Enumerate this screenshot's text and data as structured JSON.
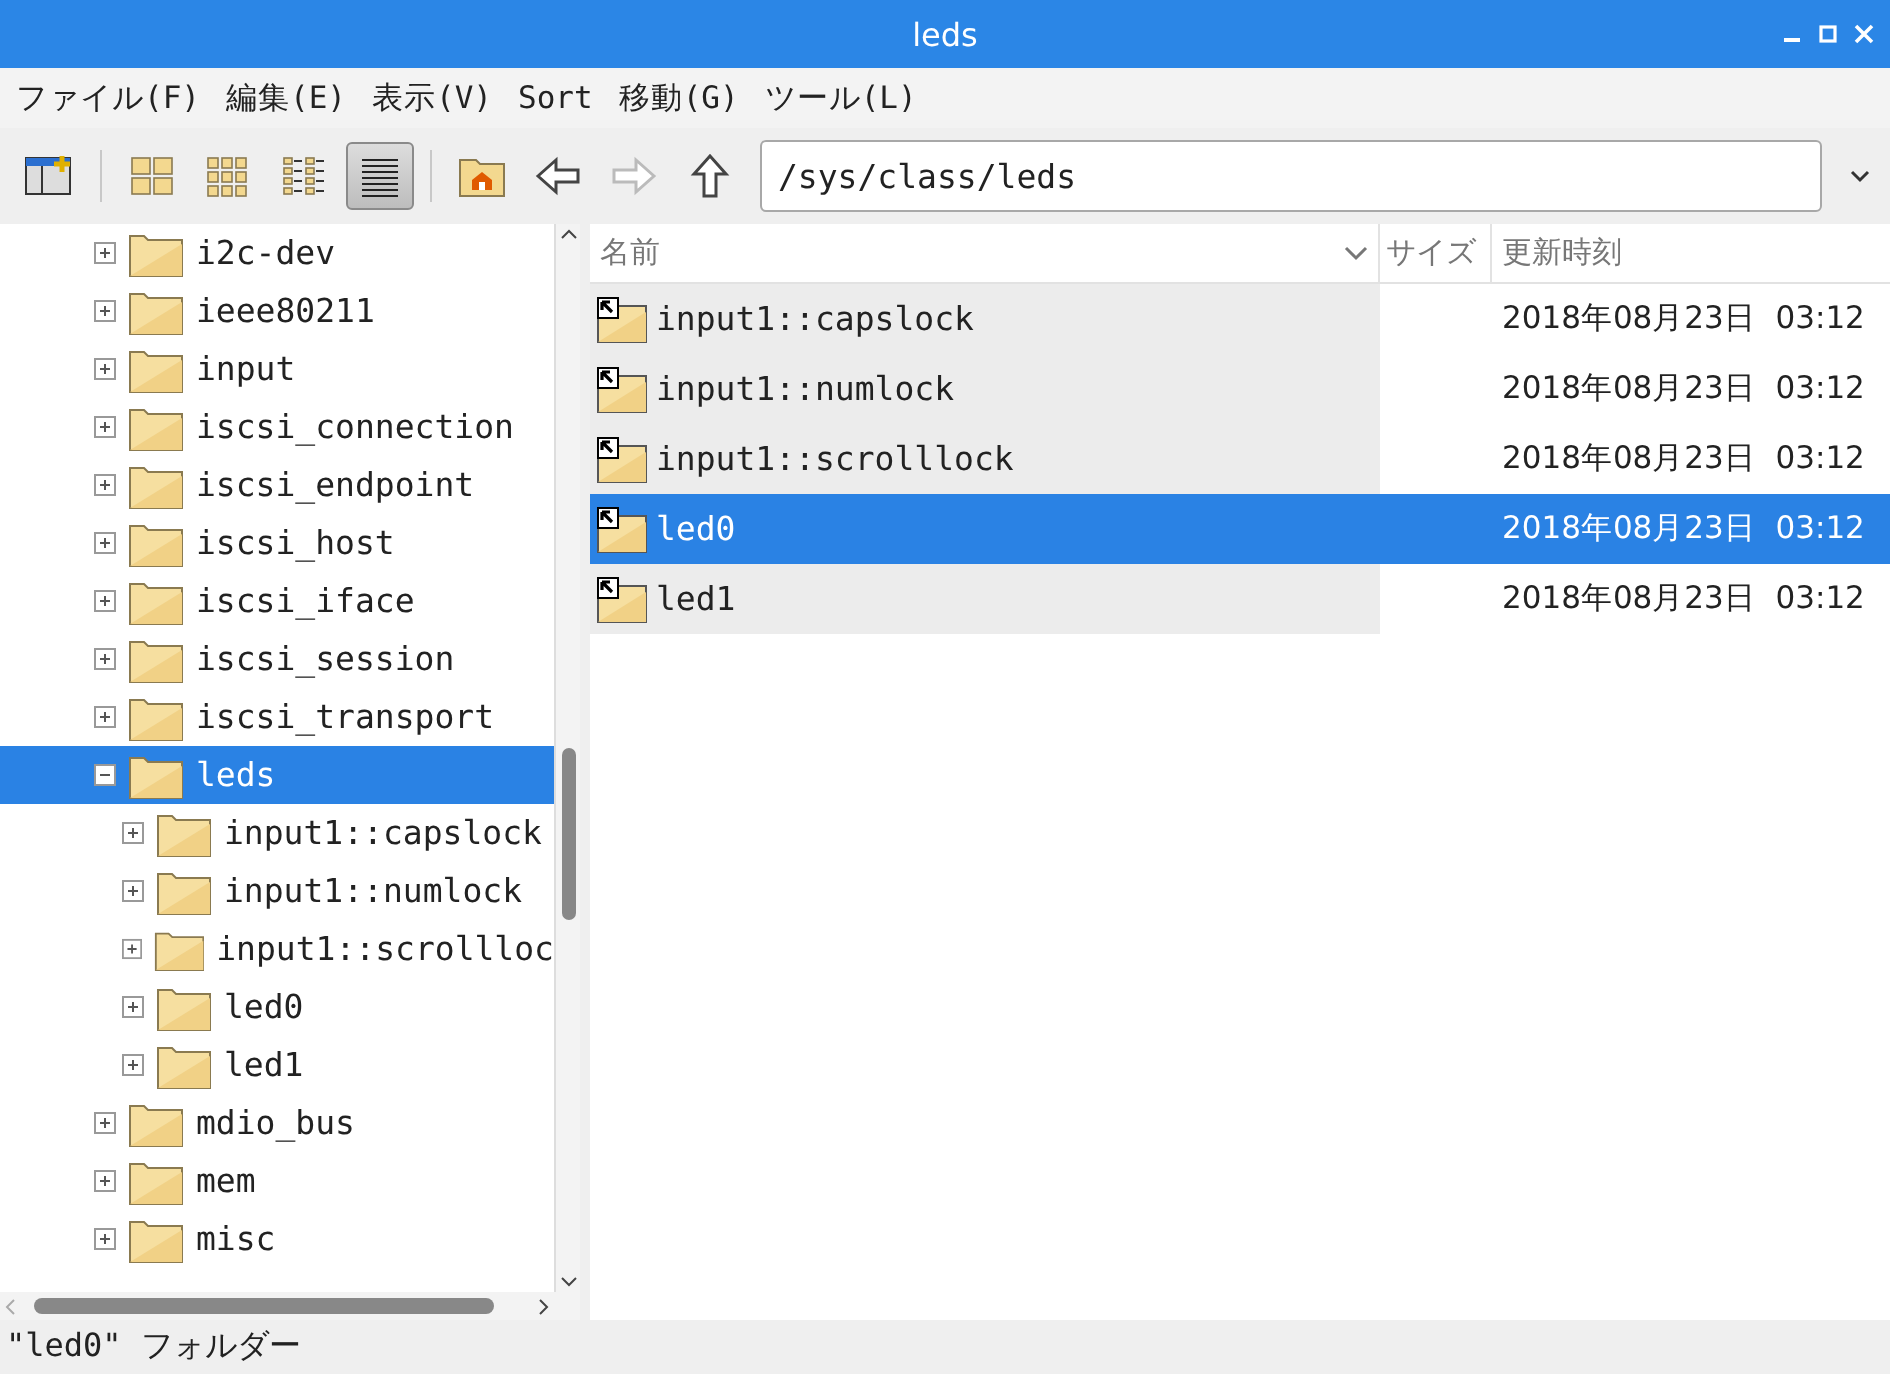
{
  "window": {
    "title": "leds"
  },
  "menu": [
    "ファイル(F)",
    "編集(E)",
    "表示(V)",
    "Sort",
    "移動(G)",
    "ツール(L)"
  ],
  "toolbar": {
    "views": [
      {
        "kind": "icons",
        "selected": false
      },
      {
        "kind": "thumbs",
        "selected": false
      },
      {
        "kind": "compact",
        "selected": false
      },
      {
        "kind": "details",
        "selected": true
      }
    ],
    "forward_disabled": true,
    "path": "/sys/class/leds"
  },
  "tree": [
    {
      "name": "i2c-dev",
      "expanded": false,
      "selected": false
    },
    {
      "name": "ieee80211",
      "expanded": false,
      "selected": false
    },
    {
      "name": "input",
      "expanded": false,
      "selected": false
    },
    {
      "name": "iscsi_connection",
      "expanded": false,
      "selected": false
    },
    {
      "name": "iscsi_endpoint",
      "expanded": false,
      "selected": false
    },
    {
      "name": "iscsi_host",
      "expanded": false,
      "selected": false
    },
    {
      "name": "iscsi_iface",
      "expanded": false,
      "selected": false
    },
    {
      "name": "iscsi_session",
      "expanded": false,
      "selected": false
    },
    {
      "name": "iscsi_transport",
      "expanded": false,
      "selected": false
    },
    {
      "name": "leds",
      "expanded": true,
      "selected": true,
      "children": [
        {
          "name": "input1::capslock",
          "expanded": false,
          "selected": false
        },
        {
          "name": "input1::numlock",
          "expanded": false,
          "selected": false
        },
        {
          "name": "input1::scrollloc",
          "expanded": false,
          "selected": false
        },
        {
          "name": "led0",
          "expanded": false,
          "selected": false
        },
        {
          "name": "led1",
          "expanded": false,
          "selected": false
        }
      ]
    },
    {
      "name": "mdio_bus",
      "expanded": false,
      "selected": false
    },
    {
      "name": "mem",
      "expanded": false,
      "selected": false
    },
    {
      "name": "misc",
      "expanded": false,
      "selected": false
    }
  ],
  "table": {
    "columns": [
      "名前",
      "サイズ",
      "更新時刻"
    ],
    "rows": [
      {
        "name": "input1::capslock",
        "modified": "2018年08月23日  03:12",
        "selected": false
      },
      {
        "name": "input1::numlock",
        "modified": "2018年08月23日  03:12",
        "selected": false
      },
      {
        "name": "input1::scrolllock",
        "modified": "2018年08月23日  03:12",
        "selected": false
      },
      {
        "name": "led0",
        "modified": "2018年08月23日  03:12",
        "selected": true
      },
      {
        "name": "led1",
        "modified": "2018年08月23日  03:12",
        "selected": false
      }
    ]
  },
  "status_bar": "\"led0\" フォルダー"
}
